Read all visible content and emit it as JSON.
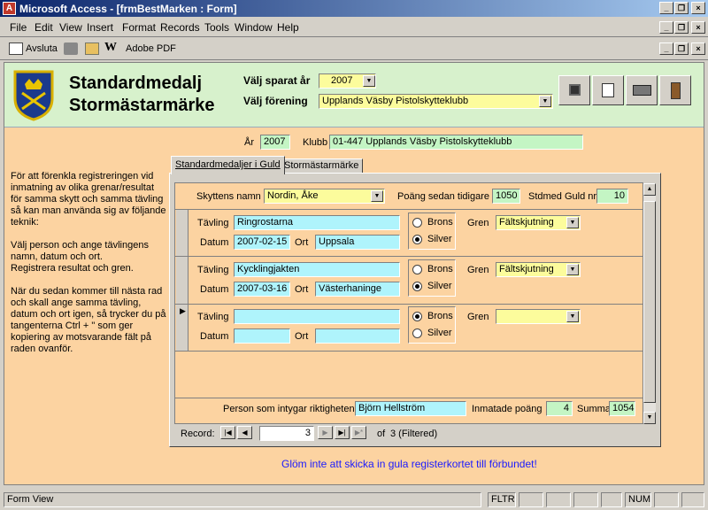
{
  "window": {
    "title": "Microsoft Access - [frmBestMarken : Form]"
  },
  "menu": [
    "File",
    "Edit",
    "View",
    "Insert",
    "Format",
    "Records",
    "Tools",
    "Window",
    "Help"
  ],
  "toolbar": {
    "avsluta": "Avsluta",
    "adobe": "Adobe PDF"
  },
  "header": {
    "title1": "Standardmedalj",
    "title2": "Stormästarmärke",
    "year_label": "Välj sparat år",
    "year_value": "2007",
    "club_label": "Välj förening",
    "club_value": "Upplands Väsby Pistolskytteklubb"
  },
  "top": {
    "ar_label": "År",
    "ar_value": "2007",
    "klubb_label": "Klubb",
    "klubb_value": "01-447 Upplands Väsby Pistolskytteklubb"
  },
  "tabs": [
    "Standardmedaljer i Guld",
    "Stormästarmärke"
  ],
  "note": "För att förenkla registreringen vid inmatning av olika grenar/resultat för samma skytt och samma tävling så kan man använda sig av följande teknik:\n\nVälj person och ange tävlingens namn, datum och ort.\nRegistrera resultat och gren.\n\nNär du sedan kommer till nästa rad och skall ange samma tävling, datum och ort igen, så trycker du på tangenterna Ctrl + \" som ger kopiering av motsvarande fält på raden ovanför.",
  "sub": {
    "skytt_label": "Skyttens namn",
    "skytt_value": "Nordin, Åke",
    "poang_label": "Poäng sedan tidigare",
    "poang_value": "1050",
    "stdmed_label": "Stdmed Guld nr",
    "stdmed_value": "10"
  },
  "labels": {
    "tavling": "Tävling",
    "datum": "Datum",
    "ort": "Ort",
    "brons": "Brons",
    "silver": "Silver",
    "gren": "Gren"
  },
  "rows": [
    {
      "tavling": "Ringrostarna",
      "datum": "2007-02-15",
      "ort": "Uppsala",
      "gren": "Fältskjutning",
      "medal": "Silver"
    },
    {
      "tavling": "Kycklingjakten",
      "datum": "2007-03-16",
      "ort": "Västerhaninge",
      "gren": "Fältskjutning",
      "medal": "Silver"
    },
    {
      "tavling": "",
      "datum": "",
      "ort": "",
      "gren": "",
      "medal": "Brons"
    }
  ],
  "footer": {
    "intygar_label": "Person som intygar riktigheten",
    "intygar_value": "Björn Hellström",
    "inmatade_label": "Inmatade poäng",
    "inmatade_value": "4",
    "summa_label": "Summa",
    "summa_value": "1054"
  },
  "nav": {
    "record_label": "Record:",
    "current": "3",
    "of_text": "of",
    "total": "3 (Filtered)"
  },
  "reminder": "Glöm inte att skicka in gula registerkortet till förbundet!",
  "statusbar": {
    "view": "Form View",
    "fltr": "FLTR",
    "num": "NUM"
  },
  "colors": {
    "form_bg": "#fcd3a1",
    "header_bg": "#d7f1cc",
    "cyan_field": "#aff4fc",
    "yellow_field": "#fcfc9c",
    "green_field": "#c4f5c4",
    "reminder": "#1a1aff"
  }
}
